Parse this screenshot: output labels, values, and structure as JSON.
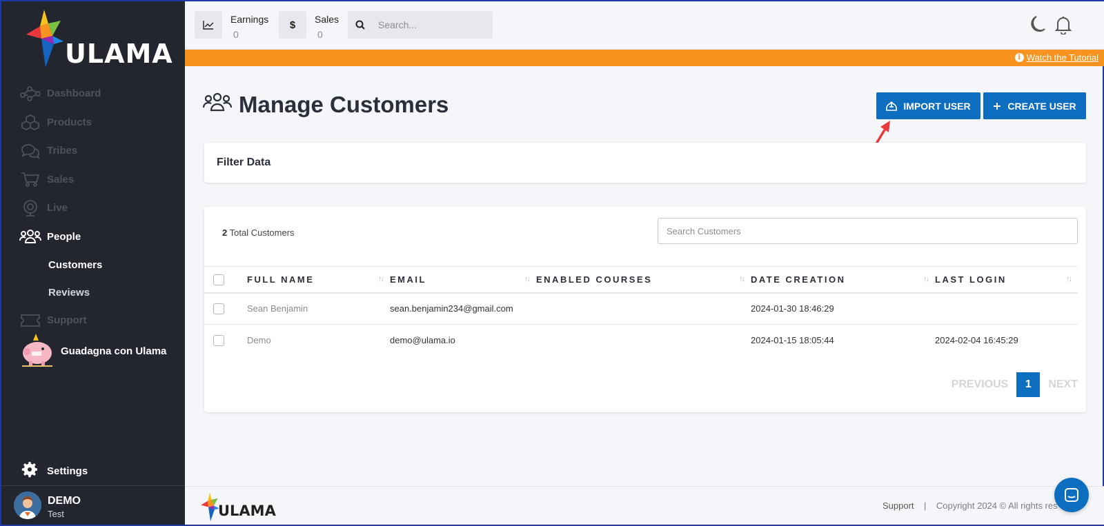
{
  "brand": {
    "name": "ULAMA"
  },
  "sidebar": {
    "items": [
      {
        "label": "Dashboard",
        "icon": "dashboard-icon"
      },
      {
        "label": "Products",
        "icon": "cubes-icon"
      },
      {
        "label": "Tribes",
        "icon": "chat-bubbles-icon"
      },
      {
        "label": "Sales",
        "icon": "cart-icon"
      },
      {
        "label": "Live",
        "icon": "webcam-icon"
      },
      {
        "label": "People",
        "icon": "people-icon"
      }
    ],
    "sub_items": [
      {
        "label": "Customers"
      },
      {
        "label": "Reviews"
      }
    ],
    "support": {
      "label": "Support",
      "icon": "ticket-icon"
    },
    "promo": {
      "label": "Guadagna con Ulama",
      "icon": "piggy-bank-icon"
    },
    "settings": {
      "label": "Settings",
      "icon": "gear-icon"
    },
    "user": {
      "name": "DEMO",
      "role": "Test"
    }
  },
  "topbar": {
    "earnings": {
      "label": "Earnings",
      "value": "0"
    },
    "sales": {
      "label": "Sales",
      "value": "0",
      "icon_text": "$"
    },
    "search_placeholder": "Search..."
  },
  "banner": {
    "link": "Watch the Tutorial",
    "color": "#f7931e"
  },
  "page": {
    "title": "Manage Customers",
    "import_button": "IMPORT USER",
    "create_button": "CREATE USER",
    "accent": "#0d6dbf"
  },
  "filter": {
    "title": "Filter Data"
  },
  "customers": {
    "total_count": "2",
    "total_label": "Total Customers",
    "search_placeholder": "Search Customers",
    "columns": [
      "FULL NAME",
      "EMAIL",
      "ENABLED COURSES",
      "DATE CREATION",
      "LAST LOGIN"
    ],
    "rows": [
      {
        "name": "Sean Benjamin",
        "email": "sean.benjamin234@gmail.com",
        "courses": "",
        "created": "2024-01-30 18:46:29",
        "last_login": ""
      },
      {
        "name": "Demo",
        "email": "demo@ulama.io",
        "courses": "",
        "created": "2024-01-15 18:05:44",
        "last_login": "2024-02-04 16:45:29"
      }
    ],
    "pagination": {
      "previous": "PREVIOUS",
      "current": "1",
      "next": "NEXT"
    }
  },
  "footer": {
    "support": "Support",
    "separator": "|",
    "copyright": "Copyright 2024 © All rights res"
  }
}
